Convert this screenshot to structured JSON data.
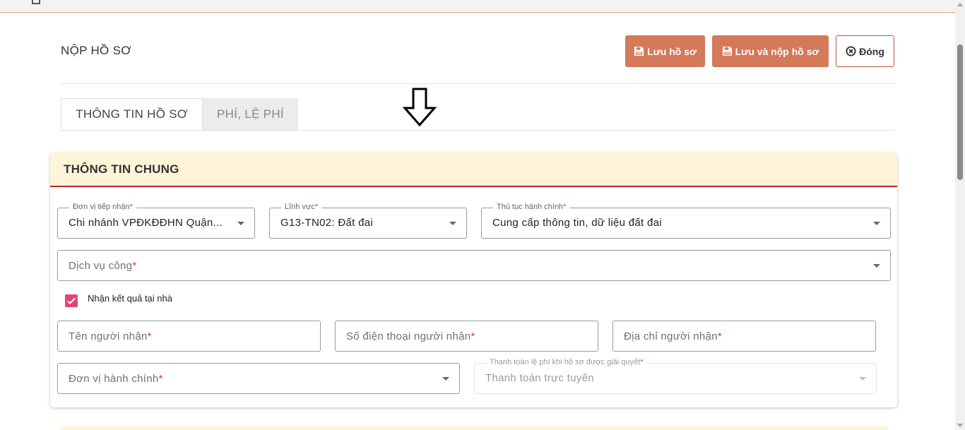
{
  "page": {
    "title": "NỘP HỒ SƠ"
  },
  "toolbar": {
    "save_label": "Lưu hồ sơ",
    "save_submit_label": "Lưu và nộp hồ sơ",
    "close_label": "Đóng"
  },
  "tabs": [
    {
      "label": "THÔNG TIN HỒ SƠ",
      "active": true
    },
    {
      "label": "PHÍ, LỆ PHÍ",
      "active": false
    }
  ],
  "section": {
    "title": "THÔNG TIN CHUNG"
  },
  "fields": {
    "don_vi_tiep_nhan": {
      "label": "Đơn vị tiếp nhận",
      "value": "Chi nhánh VPĐKĐĐHN Quận..."
    },
    "linh_vuc": {
      "label": "Lĩnh vực",
      "value": "G13-TN02: Đất đai"
    },
    "thu_tuc": {
      "label": "Thủ tục hành chính",
      "value": "Cung cấp thông tin, dữ liệu đất đai"
    },
    "dich_vu_cong": {
      "placeholder": "Dịch vụ công"
    },
    "nhan_ket_qua": {
      "label": "Nhận kết quả tại nhà",
      "checked": true
    },
    "ten_nguoi_nhan": {
      "placeholder": "Tên người nhận"
    },
    "so_dien_thoai": {
      "placeholder": "Số điện thoại người nhận"
    },
    "dia_chi": {
      "placeholder": "Địa chỉ người nhận"
    },
    "don_vi_hanh_chinh": {
      "placeholder": "Đơn vị hành chính"
    },
    "thanh_toan": {
      "label": "Thanh toán lệ phí khi hồ sơ được giải quyết",
      "value": "Thanh toán trực tuyến"
    },
    "required_mark": "*"
  },
  "icons": {
    "save": "floppy-disk-icon",
    "close": "circle-x-icon",
    "dropdown": "caret-down-icon",
    "cursor": "down-arrow-cursor-icon"
  },
  "colors": {
    "primary_button": "#d4795a",
    "section_header_bg": "#fef5d9",
    "section_header_border": "#b5262b",
    "checkbox": "#e5447a",
    "required": "#e53935"
  }
}
